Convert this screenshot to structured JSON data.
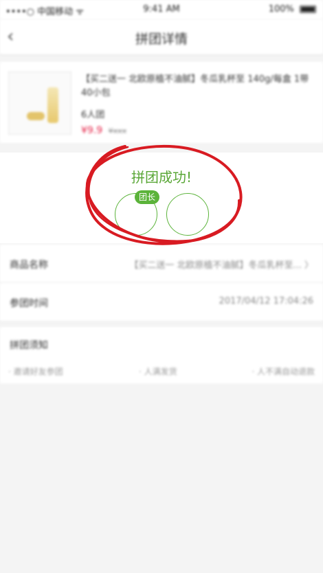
{
  "status_bar": {
    "carrier": "••••○ 中国移动 ᯤ",
    "time": "9:41 AM",
    "battery": "100%"
  },
  "nav": {
    "back_icon": "‹",
    "title": "拼团详情"
  },
  "product": {
    "name": "【买二送一 北欧原植不油腻】冬瓜乳杯至 140g/每盒 1带40小包",
    "count": "6人团",
    "price": "¥9.9",
    "original_price": "¥xxx"
  },
  "group": {
    "headline": "拼团成功!",
    "leader_badge": "团长"
  },
  "info": {
    "product_name_label": "商品名称",
    "product_name_value": "【买二送一 北欧原植不油腻】冬瓜乳杯至... 〉",
    "time_label": "参团时间",
    "time_value": "2017/04/12 17:04:26"
  },
  "rules": {
    "label": "拼团须知",
    "steps": [
      "· 邀请好友参团",
      "· 人满发货",
      "· 人不满自动退款"
    ]
  },
  "colors": {
    "accent_green": "#5bb33a",
    "price_red": "#e5264a",
    "annotation_red": "#d81b22"
  }
}
